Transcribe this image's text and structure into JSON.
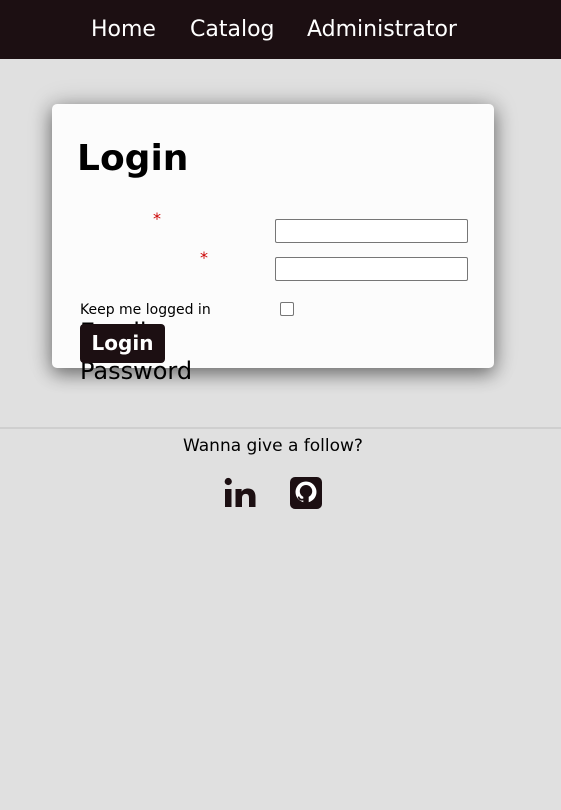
{
  "nav": {
    "items": [
      {
        "label": "Home"
      },
      {
        "label": "Catalog"
      },
      {
        "label": "Administrator"
      }
    ]
  },
  "login": {
    "title": "Login",
    "email_label": "Email",
    "password_label": "Password",
    "required_marker": "*",
    "keep_label": "Keep me logged in",
    "keep_checked": false,
    "email_value": "",
    "password_value": "",
    "submit_label": "Login"
  },
  "footer": {
    "text": "Wanna give a follow?",
    "icons": [
      "linkedin-icon",
      "github-icon"
    ]
  },
  "colors": {
    "nav_background": "#1c0f12",
    "page_background": "#e0e0e0",
    "button_background": "#1c0f12",
    "required_marker": "#cc0000"
  }
}
